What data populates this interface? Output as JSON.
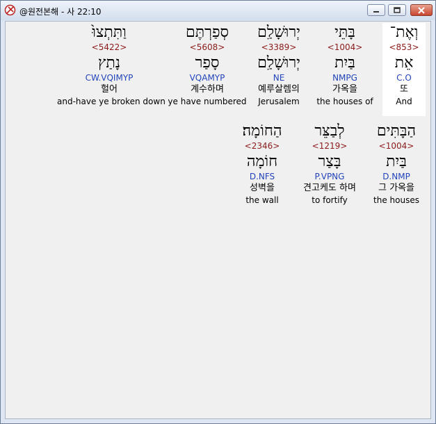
{
  "window": {
    "title": "@원전본해 - 사 22:10",
    "icon": "bible-app-icon"
  },
  "words": [
    {
      "heb": "וְאֶת־",
      "strong": "<853>",
      "lemma": "אֵת",
      "morph": "C.O",
      "kor": "또",
      "eng": "And",
      "highlight": true
    },
    {
      "heb": "בָּתֵּי",
      "strong": "<1004>",
      "lemma": "בַּיִת",
      "morph": "NMPG",
      "kor": "가옥을",
      "eng": "the houses of",
      "highlight": false
    },
    {
      "heb": "יְרוּשָׁלַ͏ִם",
      "strong": "<3389>",
      "lemma": "יְרוּשָׁלַ͏ִם",
      "morph": "NE",
      "kor": "예루살렘의",
      "eng": "Jerusalem",
      "highlight": false
    },
    {
      "heb": "סְפַרְתֶּם",
      "strong": "<5608>",
      "lemma": "סָפַר",
      "morph": "VQAMYP",
      "kor": "계수하며",
      "eng": "ye have numbered",
      "highlight": false
    },
    {
      "heb": "וַתִּתְצוּ֙",
      "strong": "<5422>",
      "lemma": "נָתַץ",
      "morph": "CW.VQIMYP",
      "kor": "헐어",
      "eng": "and-have ye broken down",
      "highlight": false
    },
    {
      "heb": "הַבָּתִּים",
      "strong": "<1004>",
      "lemma": "בַּיִת",
      "morph": "D.NMP",
      "kor": "그 가옥을",
      "eng": "the houses",
      "highlight": false
    },
    {
      "heb": "לְבַצֵּר",
      "strong": "<1219>",
      "lemma": "בָּצַר",
      "morph": "P.VPNG",
      "kor": "견고케도 하며",
      "eng": "to fortify",
      "highlight": false
    },
    {
      "heb": "הַחוֹמָה׃",
      "strong": "<2346>",
      "lemma": "חוֹמָה",
      "morph": "D.NFS",
      "kor": "성벽을",
      "eng": "the wall",
      "highlight": false
    }
  ]
}
